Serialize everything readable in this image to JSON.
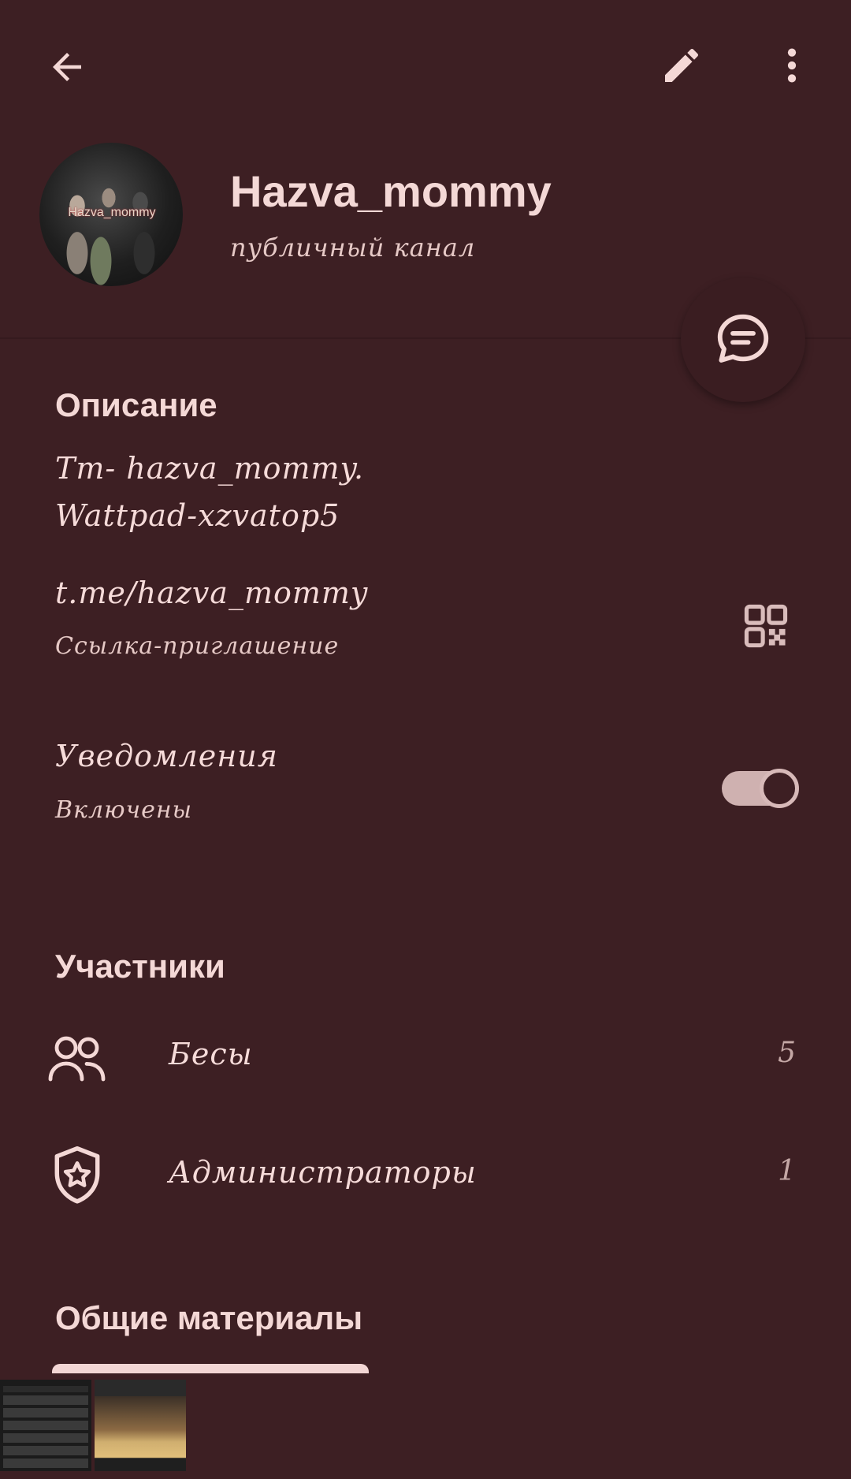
{
  "header": {
    "back_icon": "arrow-left-icon",
    "edit_icon": "pencil-icon",
    "more_icon": "more-vertical-icon"
  },
  "profile": {
    "avatar_text": "Hazva_mommy",
    "title": "Hazva_mommy",
    "subtitle": "публичный канал"
  },
  "fab": {
    "icon": "chat-icon"
  },
  "description": {
    "heading": "Описание",
    "line1": "Тт- hazva_mommy.",
    "line2": "Wattpad-xzvatop5"
  },
  "link": {
    "url": "t.me/hazva_mommy",
    "label": "Ссылка-приглашение",
    "qr_icon": "qr-code-icon"
  },
  "notifications": {
    "title": "Уведомления",
    "status": "Включены",
    "enabled": true
  },
  "participants": {
    "heading": "Участники",
    "items": [
      {
        "label": "Бесы",
        "count": "5",
        "icon": "people-icon"
      },
      {
        "label": "Администраторы",
        "count": "1",
        "icon": "shield-star-icon"
      }
    ]
  },
  "shared": {
    "heading": "Общие материалы"
  },
  "colors": {
    "background": "#3d1f23",
    "text": "#f6dbd9",
    "accent": "#f3d6d4"
  }
}
